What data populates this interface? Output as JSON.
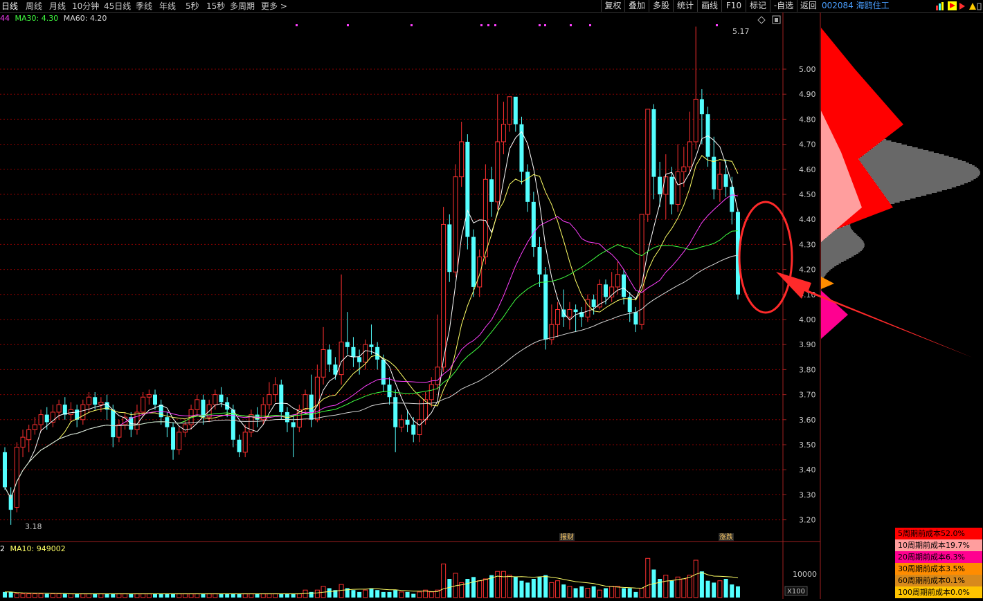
{
  "toolbar": {
    "periods": [
      "日线",
      "周线",
      "月线",
      "10分钟",
      "45日线",
      "季线",
      "年线",
      "5秒",
      "15秒",
      "多周期",
      "更多 >"
    ],
    "active_period": "日线",
    "right_buttons": [
      "复权",
      "叠加",
      "多股",
      "统计",
      "画线",
      "F10",
      "标记",
      "-自选",
      "返回"
    ]
  },
  "stock": {
    "code": "002084",
    "name": "海鸥住工",
    "code_name": "002084 海鸥住工"
  },
  "legend": {
    "ma20_frag": "44",
    "ma30": "MA30: 4.30",
    "ma60": "MA60: 4.20"
  },
  "vol_legend": {
    "left_frag": "2",
    "ma10": "MA10: 949002"
  },
  "price_axis": {
    "ticks": [
      "5.00",
      "4.90",
      "4.80",
      "4.70",
      "4.60",
      "4.50",
      "4.40",
      "4.30",
      "4.20",
      "4.10",
      "4.00",
      "3.90",
      "3.80",
      "3.70",
      "3.60",
      "3.50",
      "3.40",
      "3.30",
      "3.20"
    ]
  },
  "volume_axis": {
    "tick": "10000",
    "unit": "X100"
  },
  "annotations": {
    "high": "5.17",
    "low": "3.18",
    "event1": "报财",
    "event2": "涨跌"
  },
  "cost_panel": [
    {
      "label": "5周期前成本52.0%",
      "color": "#ff0000"
    },
    {
      "label": "10周期前成本19.7%",
      "color": "#ff9e9e"
    },
    {
      "label": "20周期前成本6.3%",
      "color": "#ff0090"
    },
    {
      "label": "30周期前成本3.5%",
      "color": "#ff8c00"
    },
    {
      "label": "60周期前成本0.1%",
      "color": "#d88a1c"
    },
    {
      "label": "100周期前成本0.0%",
      "color": "#ffc400"
    }
  ],
  "colors": {
    "up": "#ff3030",
    "down": "#54ffff",
    "ma5": "#ffffff",
    "ma10": "#ffff66",
    "ma20": "#ff40ff",
    "ma30": "#40ff40",
    "ma60": "#d8d8d8",
    "grid": "#8b0000",
    "callout": "#ff2a2a"
  },
  "chart_data": {
    "type": "candlestick",
    "price_ylim": [
      3.14,
      5.2
    ],
    "high": 5.17,
    "low": 3.18,
    "ma30_last": 4.3,
    "ma60_last": 4.2,
    "vol_ma10": 949002,
    "candles": [
      [
        3.47,
        3.33,
        3.49,
        3.32
      ],
      [
        3.3,
        3.24,
        3.33,
        3.18
      ],
      [
        3.25,
        3.49,
        3.51,
        3.23
      ],
      [
        3.49,
        3.53,
        3.56,
        3.45
      ],
      [
        3.52,
        3.56,
        3.58,
        3.47
      ],
      [
        3.56,
        3.58,
        3.61,
        3.54
      ],
      [
        3.58,
        3.62,
        3.64,
        3.55
      ],
      [
        3.62,
        3.59,
        3.65,
        3.56
      ],
      [
        3.59,
        3.63,
        3.66,
        3.57
      ],
      [
        3.63,
        3.66,
        3.68,
        3.6
      ],
      [
        3.66,
        3.62,
        3.69,
        3.6
      ],
      [
        3.62,
        3.64,
        3.67,
        3.59
      ],
      [
        3.64,
        3.6,
        3.66,
        3.57
      ],
      [
        3.6,
        3.66,
        3.68,
        3.58
      ],
      [
        3.66,
        3.69,
        3.71,
        3.63
      ],
      [
        3.69,
        3.66,
        3.71,
        3.64
      ],
      [
        3.66,
        3.67,
        3.69,
        3.63
      ],
      [
        3.67,
        3.64,
        3.7,
        3.6
      ],
      [
        3.64,
        3.53,
        3.66,
        3.49
      ],
      [
        3.53,
        3.58,
        3.6,
        3.51
      ],
      [
        3.58,
        3.61,
        3.63,
        3.56
      ],
      [
        3.61,
        3.56,
        3.63,
        3.53
      ],
      [
        3.56,
        3.63,
        3.66,
        3.54
      ],
      [
        3.63,
        3.69,
        3.71,
        3.61
      ],
      [
        3.69,
        3.7,
        3.72,
        3.66
      ],
      [
        3.7,
        3.66,
        3.72,
        3.64
      ],
      [
        3.66,
        3.61,
        3.68,
        3.58
      ],
      [
        3.61,
        3.57,
        3.63,
        3.53
      ],
      [
        3.57,
        3.48,
        3.59,
        3.44
      ],
      [
        3.48,
        3.55,
        3.57,
        3.46
      ],
      [
        3.55,
        3.58,
        3.6,
        3.53
      ],
      [
        3.58,
        3.64,
        3.66,
        3.56
      ],
      [
        3.64,
        3.68,
        3.7,
        3.62
      ],
      [
        3.68,
        3.61,
        3.7,
        3.58
      ],
      [
        3.61,
        3.66,
        3.68,
        3.59
      ],
      [
        3.66,
        3.7,
        3.72,
        3.64
      ],
      [
        3.7,
        3.67,
        3.73,
        3.65
      ],
      [
        3.67,
        3.64,
        3.69,
        3.61
      ],
      [
        3.64,
        3.52,
        3.66,
        3.49
      ],
      [
        3.52,
        3.47,
        3.54,
        3.45
      ],
      [
        3.47,
        3.55,
        3.58,
        3.45
      ],
      [
        3.55,
        3.62,
        3.64,
        3.53
      ],
      [
        3.62,
        3.6,
        3.65,
        3.57
      ],
      [
        3.6,
        3.66,
        3.69,
        3.58
      ],
      [
        3.66,
        3.7,
        3.75,
        3.64
      ],
      [
        3.7,
        3.74,
        3.77,
        3.67
      ],
      [
        3.74,
        3.63,
        3.76,
        3.6
      ],
      [
        3.63,
        3.59,
        3.65,
        3.55
      ],
      [
        3.59,
        3.57,
        3.62,
        3.45
      ],
      [
        3.57,
        3.64,
        3.66,
        3.55
      ],
      [
        3.64,
        3.7,
        3.72,
        3.62
      ],
      [
        3.7,
        3.6,
        3.78,
        3.57
      ],
      [
        3.6,
        3.77,
        3.82,
        3.59
      ],
      [
        3.77,
        3.88,
        3.97,
        3.74
      ],
      [
        3.88,
        3.82,
        3.9,
        3.79
      ],
      [
        3.82,
        3.78,
        3.85,
        3.76
      ],
      [
        3.78,
        3.91,
        4.18,
        3.74
      ],
      [
        3.91,
        3.89,
        4.03,
        3.86
      ],
      [
        3.89,
        3.85,
        3.93,
        3.81
      ],
      [
        3.85,
        3.83,
        3.88,
        3.78
      ],
      [
        3.83,
        3.9,
        3.92,
        3.8
      ],
      [
        3.9,
        3.89,
        3.98,
        3.86
      ],
      [
        3.89,
        3.84,
        3.91,
        3.8
      ],
      [
        3.84,
        3.74,
        3.86,
        3.71
      ],
      [
        3.74,
        3.69,
        3.77,
        3.66
      ],
      [
        3.69,
        3.57,
        3.72,
        3.47
      ],
      [
        3.57,
        3.6,
        3.62,
        3.55
      ],
      [
        3.6,
        3.58,
        3.64,
        3.55
      ],
      [
        3.58,
        3.54,
        3.61,
        3.51
      ],
      [
        3.54,
        3.6,
        3.68,
        3.51
      ],
      [
        3.6,
        3.68,
        3.71,
        3.58
      ],
      [
        3.68,
        3.74,
        3.77,
        3.65
      ],
      [
        3.74,
        3.81,
        4.02,
        3.72
      ],
      [
        3.81,
        4.38,
        4.45,
        3.79
      ],
      [
        4.38,
        4.19,
        4.42,
        4.15
      ],
      [
        4.19,
        4.57,
        4.62,
        4.17
      ],
      [
        4.57,
        4.71,
        4.79,
        4.53
      ],
      [
        4.71,
        4.33,
        4.74,
        4.28
      ],
      [
        4.33,
        4.13,
        4.36,
        4.09
      ],
      [
        4.13,
        4.25,
        4.28,
        4.09
      ],
      [
        4.25,
        4.56,
        4.62,
        4.22
      ],
      [
        4.56,
        4.47,
        4.61,
        4.41
      ],
      [
        4.47,
        4.71,
        4.9,
        4.44
      ],
      [
        4.71,
        4.78,
        4.87,
        4.66
      ],
      [
        4.78,
        4.89,
        4.89,
        4.75
      ],
      [
        4.89,
        4.78,
        4.87,
        4.75
      ],
      [
        4.78,
        4.59,
        4.81,
        4.54
      ],
      [
        4.59,
        4.47,
        4.62,
        4.43
      ],
      [
        4.47,
        4.29,
        4.51,
        4.25
      ],
      [
        4.29,
        4.18,
        4.33,
        4.13
      ],
      [
        4.18,
        3.92,
        4.21,
        3.88
      ],
      [
        3.92,
        3.98,
        4.06,
        3.9
      ],
      [
        3.98,
        4.04,
        4.07,
        3.93
      ],
      [
        4.04,
        4.01,
        4.12,
        3.97
      ],
      [
        4.01,
        4.04,
        4.07,
        3.96
      ],
      [
        4.04,
        4.03,
        4.06,
        3.95
      ],
      [
        4.03,
        4.01,
        4.05,
        3.97
      ],
      [
        4.01,
        4.08,
        4.1,
        3.99
      ],
      [
        4.08,
        4.05,
        4.1,
        4.02
      ],
      [
        4.05,
        4.14,
        4.16,
        4.04
      ],
      [
        4.14,
        4.09,
        4.16,
        4.06
      ],
      [
        4.09,
        4.13,
        4.19,
        4.07
      ],
      [
        4.13,
        4.18,
        4.23,
        4.1
      ],
      [
        4.18,
        4.09,
        4.2,
        4.06
      ],
      [
        4.09,
        4.03,
        4.11,
        3.99
      ],
      [
        4.03,
        3.98,
        4.05,
        3.95
      ],
      [
        3.98,
        4.42,
        4.42,
        3.96
      ],
      [
        4.42,
        4.84,
        4.84,
        4.39
      ],
      [
        4.84,
        4.57,
        4.86,
        4.48
      ],
      [
        4.57,
        4.5,
        4.63,
        4.45
      ],
      [
        4.5,
        4.57,
        4.66,
        4.4
      ],
      [
        4.57,
        4.46,
        4.61,
        4.42
      ],
      [
        4.46,
        4.59,
        4.7,
        4.43
      ],
      [
        4.59,
        4.61,
        4.69,
        4.53
      ],
      [
        4.61,
        4.71,
        4.83,
        4.58
      ],
      [
        4.71,
        4.88,
        5.17,
        4.68
      ],
      [
        4.88,
        4.82,
        4.92,
        4.7
      ],
      [
        4.82,
        4.65,
        4.85,
        4.61
      ],
      [
        4.65,
        4.52,
        4.73,
        4.48
      ],
      [
        4.52,
        4.58,
        4.63,
        4.47
      ],
      [
        4.58,
        4.53,
        4.64,
        4.49
      ],
      [
        4.53,
        4.43,
        4.57,
        4.38
      ],
      [
        4.43,
        4.1,
        4.44,
        4.08
      ]
    ],
    "volume": [
      3,
      3,
      2,
      2,
      2,
      2,
      2,
      2,
      2,
      2,
      2,
      2,
      2,
      2,
      2,
      2,
      2,
      2,
      2,
      2,
      2,
      2,
      2,
      2,
      2,
      2,
      2,
      2,
      2,
      2,
      2,
      2,
      2,
      2,
      2,
      2,
      2,
      2,
      2,
      2,
      2,
      2,
      2,
      2,
      2,
      2,
      2,
      2,
      2,
      2,
      4,
      3,
      4,
      6,
      5,
      4,
      7,
      5,
      4,
      3,
      4,
      5,
      4,
      3,
      3,
      4,
      3,
      3,
      2,
      3,
      4,
      3,
      4,
      18,
      10,
      13,
      8,
      10,
      11,
      9,
      10,
      12,
      14,
      14,
      12,
      11,
      9,
      8,
      10,
      11,
      12,
      8,
      9,
      7,
      6,
      5,
      6,
      5,
      6,
      4,
      5,
      6,
      6,
      5,
      5,
      3,
      5,
      21,
      15,
      10,
      12,
      9,
      11,
      10,
      12,
      20,
      14,
      9,
      8,
      9,
      10,
      7,
      6
    ]
  }
}
